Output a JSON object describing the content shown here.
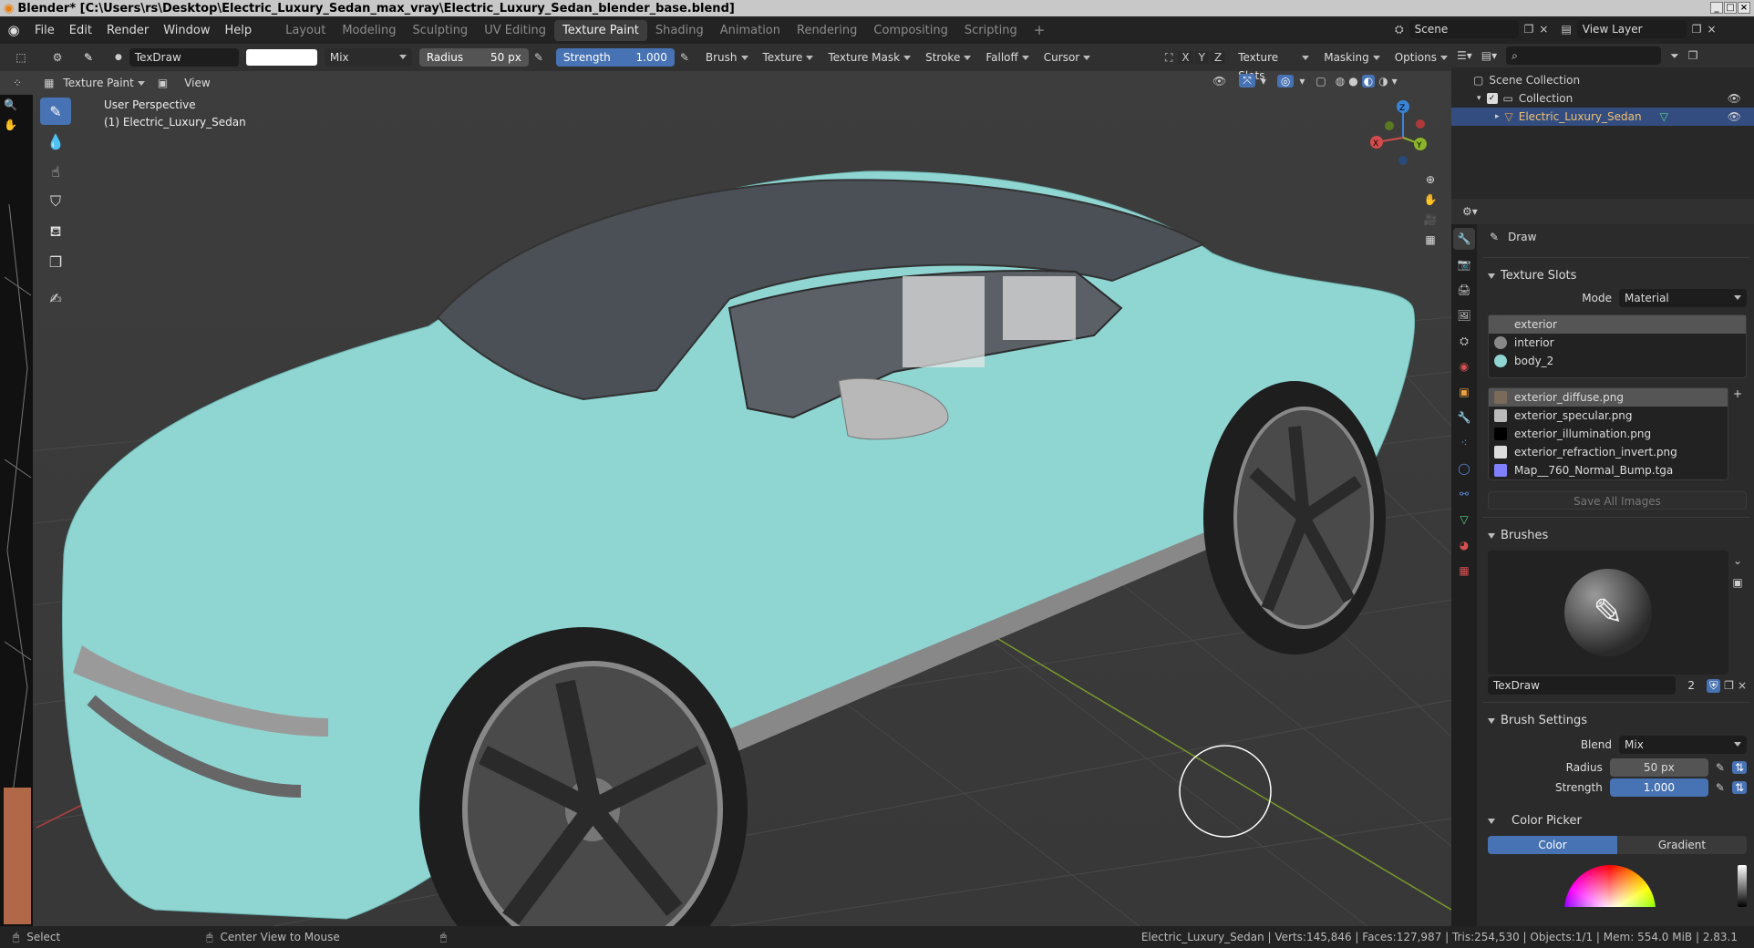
{
  "window": {
    "title": "Blender* [C:\\Users\\rs\\Desktop\\Electric_Luxury_Sedan_max_vray\\Electric_Luxury_Sedan_blender_base.blend]"
  },
  "menus": [
    "File",
    "Edit",
    "Render",
    "Window",
    "Help"
  ],
  "workspaces": [
    "Layout",
    "Modeling",
    "Sculpting",
    "UV Editing",
    "Texture Paint",
    "Shading",
    "Animation",
    "Rendering",
    "Compositing",
    "Scripting"
  ],
  "active_workspace": "Texture Paint",
  "scene": {
    "name": "Scene",
    "view_layer": "View Layer"
  },
  "tool_header": {
    "brush_name": "TexDraw",
    "blend": "Mix",
    "radius_label": "Radius",
    "radius_value": "50 px",
    "strength_label": "Strength",
    "strength_value": "1.000",
    "menus": [
      "Brush",
      "Texture",
      "Texture Mask",
      "Stroke",
      "Falloff",
      "Cursor"
    ],
    "axes": [
      "X",
      "Y",
      "Z"
    ],
    "right_menus": [
      "Texture Slots",
      "Masking",
      "Options"
    ]
  },
  "mode_header": {
    "mode": "Texture Paint",
    "view": "View"
  },
  "viewport": {
    "perspective": "User Perspective",
    "object": "(1) Electric_Luxury_Sedan",
    "gizmo_axes": {
      "x": "X",
      "y": "Y",
      "z": "Z"
    }
  },
  "outliner": {
    "root": "Scene Collection",
    "collection": "Collection",
    "object": "Electric_Luxury_Sedan"
  },
  "properties": {
    "tool_name": "Draw",
    "texture_slots_title": "Texture Slots",
    "mode_label": "Mode",
    "mode_value": "Material",
    "materials": [
      {
        "name": "exterior",
        "color": "#555555"
      },
      {
        "name": "interior",
        "color": "#888888"
      },
      {
        "name": "body_2",
        "color": "#8fd6d3"
      }
    ],
    "images": [
      {
        "name": "exterior_diffuse.png",
        "color": "#7a6a5a"
      },
      {
        "name": "exterior_specular.png",
        "color": "#bbbbbb"
      },
      {
        "name": "exterior_illumination.png",
        "color": "#000000"
      },
      {
        "name": "exterior_refraction_invert.png",
        "color": "#dddddd"
      },
      {
        "name": "Map__760_Normal_Bump.tga",
        "color": "#8080ff"
      }
    ],
    "save_all": "Save All Images",
    "brushes_title": "Brushes",
    "brush_name": "TexDraw",
    "brush_users": "2",
    "brush_settings_title": "Brush Settings",
    "blend_label": "Blend",
    "blend_value": "Mix",
    "radius_label": "Radius",
    "radius_value": "50 px",
    "strength_label": "Strength",
    "strength_value": "1.000",
    "color_picker_title": "Color Picker",
    "color_tab": "Color",
    "gradient_tab": "Gradient"
  },
  "statusbar": {
    "left": "Select",
    "middle": "Center View to Mouse",
    "right": "Electric_Luxury_Sedan | Verts:145,846 | Faces:127,987 | Tris:254,530 | Objects:1/1 | Mem: 554.0 MiB | 2.83.1"
  },
  "colors": {
    "accent": "#4772b3",
    "car_body": "#8fd6d3",
    "selection": "#334d80"
  }
}
